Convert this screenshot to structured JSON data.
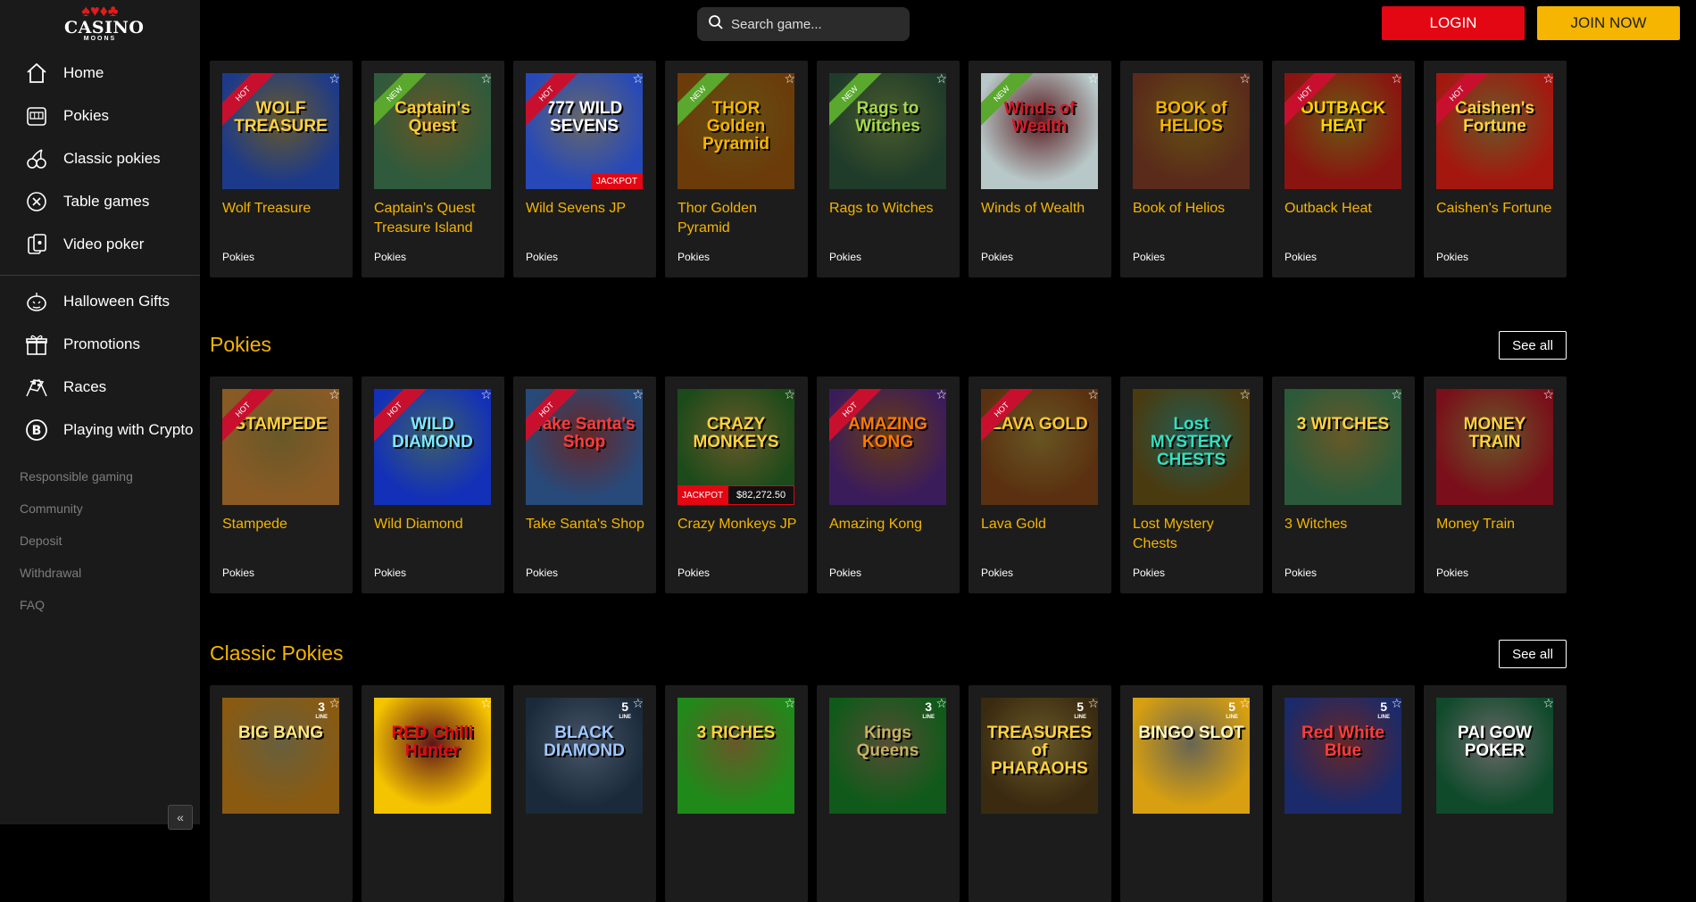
{
  "brand": {
    "top": "♠♥♦♣",
    "name": "CASINO",
    "sub": "MOONS"
  },
  "sidebar": {
    "main_items": [
      {
        "label": "Home",
        "icon": "home-icon"
      },
      {
        "label": "Pokies",
        "icon": "slot-machine-icon"
      },
      {
        "label": "Classic pokies",
        "icon": "cherries-icon"
      },
      {
        "label": "Table games",
        "icon": "poker-chip-icon"
      },
      {
        "label": "Video poker",
        "icon": "cards-icon"
      }
    ],
    "extra_items": [
      {
        "label": "Halloween Gifts",
        "icon": "pumpkin-icon"
      },
      {
        "label": "Promotions",
        "icon": "gift-icon"
      },
      {
        "label": "Races",
        "icon": "race-flags-icon"
      },
      {
        "label": "Playing with Crypto",
        "icon": "bitcoin-icon"
      }
    ],
    "secondary_links": [
      "Responsible gaming",
      "Community",
      "Deposit",
      "Withdrawal",
      "FAQ"
    ],
    "collapse_label": "«"
  },
  "header": {
    "search_placeholder": "Search game...",
    "login_label": "LOGIN",
    "join_label": "JOIN NOW"
  },
  "sections": [
    {
      "title": "",
      "see_all": "",
      "games": [
        {
          "name": "Wolf Treasure",
          "category": "Pokies",
          "badge": "HOT",
          "art": "WOLF TREASURE",
          "bg": "#1d3a8a",
          "fg": "#ffd23f"
        },
        {
          "name": "Captain's Quest Treasure Island",
          "category": "Pokies",
          "badge": "NEW",
          "art": "Captain's Quest",
          "bg": "#2f5a3c",
          "fg": "#ffcc33"
        },
        {
          "name": "Wild Sevens JP",
          "category": "Pokies",
          "badge": "HOT",
          "jackpot": "JACKPOT",
          "art": "777 WILD SEVENS",
          "bg": "#2749b8",
          "fg": "#ffffff"
        },
        {
          "name": "Thor Golden Pyramid",
          "category": "Pokies",
          "badge": "NEW",
          "art": "THOR Golden Pyramid",
          "bg": "#6b3b0a",
          "fg": "#f5b500"
        },
        {
          "name": "Rags to Witches",
          "category": "Pokies",
          "badge": "NEW",
          "art": "Rags to Witches",
          "bg": "#1f3b2a",
          "fg": "#a5d94a"
        },
        {
          "name": "Winds of Wealth",
          "category": "Pokies",
          "badge": "NEW",
          "art": "Winds of Wealth",
          "bg": "#b8c8c8",
          "fg": "#d11c2a"
        },
        {
          "name": "Book of Helios",
          "category": "Pokies",
          "badge": "",
          "art": "BOOK of HELIOS",
          "bg": "#5a2a1a",
          "fg": "#f5b500"
        },
        {
          "name": "Outback Heat",
          "category": "Pokies",
          "badge": "HOT",
          "art": "OUTBACK HEAT",
          "bg": "#8a1410",
          "fg": "#ffd400"
        },
        {
          "name": "Caishen's Fortune",
          "category": "Pokies",
          "badge": "HOT",
          "art": "Caishen's Fortune",
          "bg": "#a4170f",
          "fg": "#ffd23f"
        }
      ]
    },
    {
      "title": "Pokies",
      "see_all": "See all",
      "games": [
        {
          "name": "Stampede",
          "category": "Pokies",
          "badge": "HOT",
          "art": "STAMPEDE",
          "bg": "#8a5a25",
          "fg": "#ffd23f"
        },
        {
          "name": "Wild Diamond",
          "category": "Pokies",
          "badge": "HOT",
          "art": "WILD DIAMOND",
          "bg": "#1330b8",
          "fg": "#7ee8ff"
        },
        {
          "name": "Take Santa's Shop",
          "category": "Pokies",
          "badge": "HOT",
          "art": "Take Santa's Shop",
          "bg": "#274a7a",
          "fg": "#ff3b3b"
        },
        {
          "name": "Crazy Monkeys JP",
          "category": "Pokies",
          "badge": "",
          "jackpot_label": "JACKPOT",
          "jackpot_value": "$82,272.50",
          "art": "CRAZY MONKEYS",
          "bg": "#1c4a1a",
          "fg": "#ffd23f"
        },
        {
          "name": "Amazing Kong",
          "category": "Pokies",
          "badge": "HOT",
          "art": "AMAZING KONG",
          "bg": "#3b1c5a",
          "fg": "#ff7a00"
        },
        {
          "name": "Lava Gold",
          "category": "Pokies",
          "badge": "HOT",
          "art": "LAVA GOLD",
          "bg": "#5a3010",
          "fg": "#ffc830"
        },
        {
          "name": "Lost Mystery Chests",
          "category": "Pokies",
          "badge": "",
          "art": "Lost MYSTERY CHESTS",
          "bg": "#4a3a10",
          "fg": "#32e0c0"
        },
        {
          "name": "3 Witches",
          "category": "Pokies",
          "badge": "",
          "art": "3 WITCHES",
          "bg": "#2a5a3a",
          "fg": "#ffd23f"
        },
        {
          "name": "Money Train",
          "category": "Pokies",
          "badge": "",
          "art": "MONEY TRAIN",
          "bg": "#7a0e1a",
          "fg": "#ffd23f"
        }
      ]
    },
    {
      "title": "Classic Pokies",
      "see_all": "See all",
      "games": [
        {
          "name": "",
          "category": "",
          "badge": "",
          "lines": "3",
          "art": "BIG BANG",
          "bg": "#8a5a10",
          "fg": "#ffe680"
        },
        {
          "name": "",
          "category": "",
          "badge": "",
          "art": "RED Chilli Hunter",
          "bg": "#f5c400",
          "fg": "#e30613"
        },
        {
          "name": "",
          "category": "",
          "badge": "",
          "lines": "5",
          "art": "BLACK DIAMOND",
          "bg": "#1a2a3a",
          "fg": "#9ec7ff"
        },
        {
          "name": "",
          "category": "",
          "badge": "",
          "art": "3 RICHES",
          "bg": "#1f8a1a",
          "fg": "#ffd23f"
        },
        {
          "name": "",
          "category": "",
          "badge": "",
          "lines": "3",
          "art": "Kings Queens",
          "bg": "#0f5a1a",
          "fg": "#c8b060"
        },
        {
          "name": "",
          "category": "",
          "badge": "",
          "lines": "5",
          "art": "TREASURES of PHARAOHS",
          "bg": "#3a2a10",
          "fg": "#ffd23f"
        },
        {
          "name": "",
          "category": "",
          "badge": "",
          "lines": "5",
          "art": "BINGO SLOT",
          "bg": "#d8a010",
          "fg": "#fff6c0"
        },
        {
          "name": "",
          "category": "",
          "badge": "",
          "lines": "5",
          "art": "Red White Blue",
          "bg": "#1a2a6a",
          "fg": "#ff3b3b"
        },
        {
          "name": "",
          "category": "",
          "badge": "",
          "art": "PAI GOW POKER",
          "bg": "#0f4a2a",
          "fg": "#ffffff"
        }
      ]
    }
  ],
  "lines_label": "LINE"
}
